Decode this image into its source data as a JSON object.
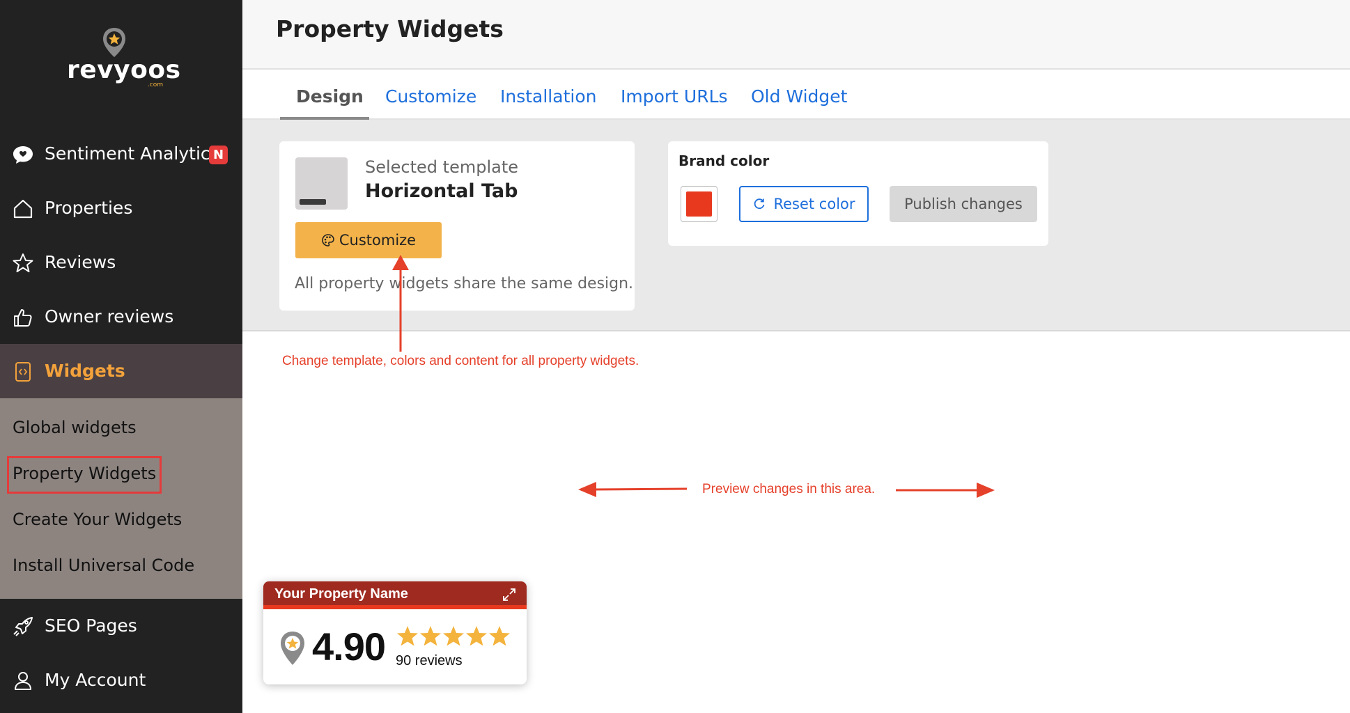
{
  "brand": {
    "name": "revyoos",
    "tld": ".com"
  },
  "sidebar": {
    "items": [
      {
        "label": "Sentiment Analytics",
        "icon": "chat-bubble-icon",
        "badge": "N"
      },
      {
        "label": "Properties",
        "icon": "house-icon"
      },
      {
        "label": "Reviews",
        "icon": "star-outline-icon"
      },
      {
        "label": "Owner reviews",
        "icon": "thumbs-up-icon"
      },
      {
        "label": "Widgets",
        "icon": "widget-code-icon",
        "active": true
      },
      {
        "label": "SEO Pages",
        "icon": "rocket-icon"
      },
      {
        "label": "My Account",
        "icon": "user-icon"
      }
    ],
    "sub_items": [
      {
        "label": "Global widgets"
      },
      {
        "label": "Property Widgets",
        "selected": true
      },
      {
        "label": "Create Your Widgets"
      },
      {
        "label": "Install Universal Code"
      }
    ]
  },
  "header": {
    "title": "Property Widgets"
  },
  "tabs": [
    {
      "label": "Design",
      "active": true
    },
    {
      "label": "Customize"
    },
    {
      "label": "Installation"
    },
    {
      "label": "Import URLs"
    },
    {
      "label": "Old Widget"
    }
  ],
  "template_card": {
    "selected_label": "Selected template",
    "template_name": "Horizontal Tab",
    "customize_label": "Customize",
    "note": "All property widgets share the same design."
  },
  "brand_card": {
    "label": "Brand color",
    "color": "#e8391f",
    "reset_label": "Reset color",
    "publish_label": "Publish changes"
  },
  "annotations": {
    "template_hint": "Change template, colors and content for all property widgets.",
    "preview_hint": "Preview changes in this area."
  },
  "widget_preview": {
    "property_name": "Your Property Name",
    "rating": "4.90",
    "stars": 5,
    "reviews": "90 reviews"
  },
  "colors": {
    "sidebar_bg": "#222222",
    "accent_orange": "#f3a23b",
    "link_blue": "#1e6fdc",
    "annotation_red": "#e5402a",
    "widget_header": "#9f2a1f"
  }
}
